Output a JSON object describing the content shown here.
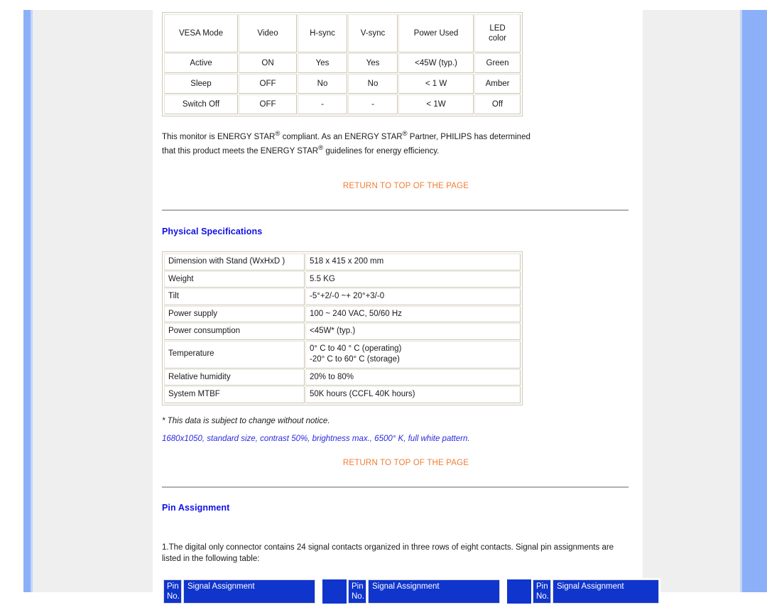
{
  "power_table": {
    "headers": [
      "VESA Mode",
      "Video",
      "H-sync",
      "V-sync",
      "Power Used",
      "LED\ncolor"
    ],
    "rows": [
      [
        "Active",
        "ON",
        "Yes",
        "Yes",
        "<45W (typ.)",
        "Green"
      ],
      [
        "Sleep",
        "OFF",
        "No",
        "No",
        "< 1 W",
        "Amber"
      ],
      [
        "Switch Off",
        "OFF",
        "-",
        "-",
        "< 1W",
        "Off"
      ]
    ]
  },
  "energy_star": {
    "line1": "This monitor is ENERGY STAR",
    "line1b": " compliant. As an ENERGY STAR",
    "line1c": " Partner, PHILIPS has",
    "line2a": "determined that this product meets the ENERGY STAR",
    "line2b": " guidelines for energy efficiency.",
    "reg_mark": "®"
  },
  "return_links": {
    "label": "RETURN TO TOP OF THE PAGE",
    "color": "#f07d33"
  },
  "physical": {
    "heading": "Physical Specifications",
    "rows": [
      {
        "key": "Dimension with Stand  (WxHxD )",
        "value": "518 x 415 x 200 mm"
      },
      {
        "key": "Weight",
        "value": "5.5 KG"
      },
      {
        "key": "Tilt",
        "value": "-5°+2/-0 ~+ 20°+3/-0"
      },
      {
        "key": "Power supply",
        "value": "100 ~ 240 VAC, 50/60 Hz"
      },
      {
        "key": "Power consumption",
        "value": "<45W* (typ.)"
      },
      {
        "key": "Temperature",
        "value": "0° C to 40 ° C (operating)\n-20° C to 60° C (storage)"
      },
      {
        "key": "Relative humidity",
        "value": "20% to 80%"
      },
      {
        "key": "System MTBF",
        "value": "50K hours (CCFL 40K hours)"
      }
    ],
    "footnote": "* This data is subject to change without notice.",
    "blue_note": "1680x1050, standard size, contrast 50%, brightness max., 6500° K, full white pattern."
  },
  "pin_assignment": {
    "heading": "Pin Assignment",
    "intro": "1.The digital only connector contains 24 signal contacts organized in three rows of eight contacts. Signal pin assignments are listed in the following table:",
    "groups": [
      {
        "pin_no": "Pin\nNo.",
        "signal": "Signal Assignment"
      },
      {
        "pin_no": "Pin\nNo.",
        "signal": "Signal Assignment"
      },
      {
        "pin_no": "Pin\nNo.",
        "signal": "Signal Assignment"
      }
    ],
    "header_color": "#0f35cc"
  },
  "theme": {
    "rail_color": "#8cb0f7",
    "rail_inner_color": "#c3d5fb",
    "page_bg": "#efefef",
    "heading_color": "#1010e8"
  }
}
